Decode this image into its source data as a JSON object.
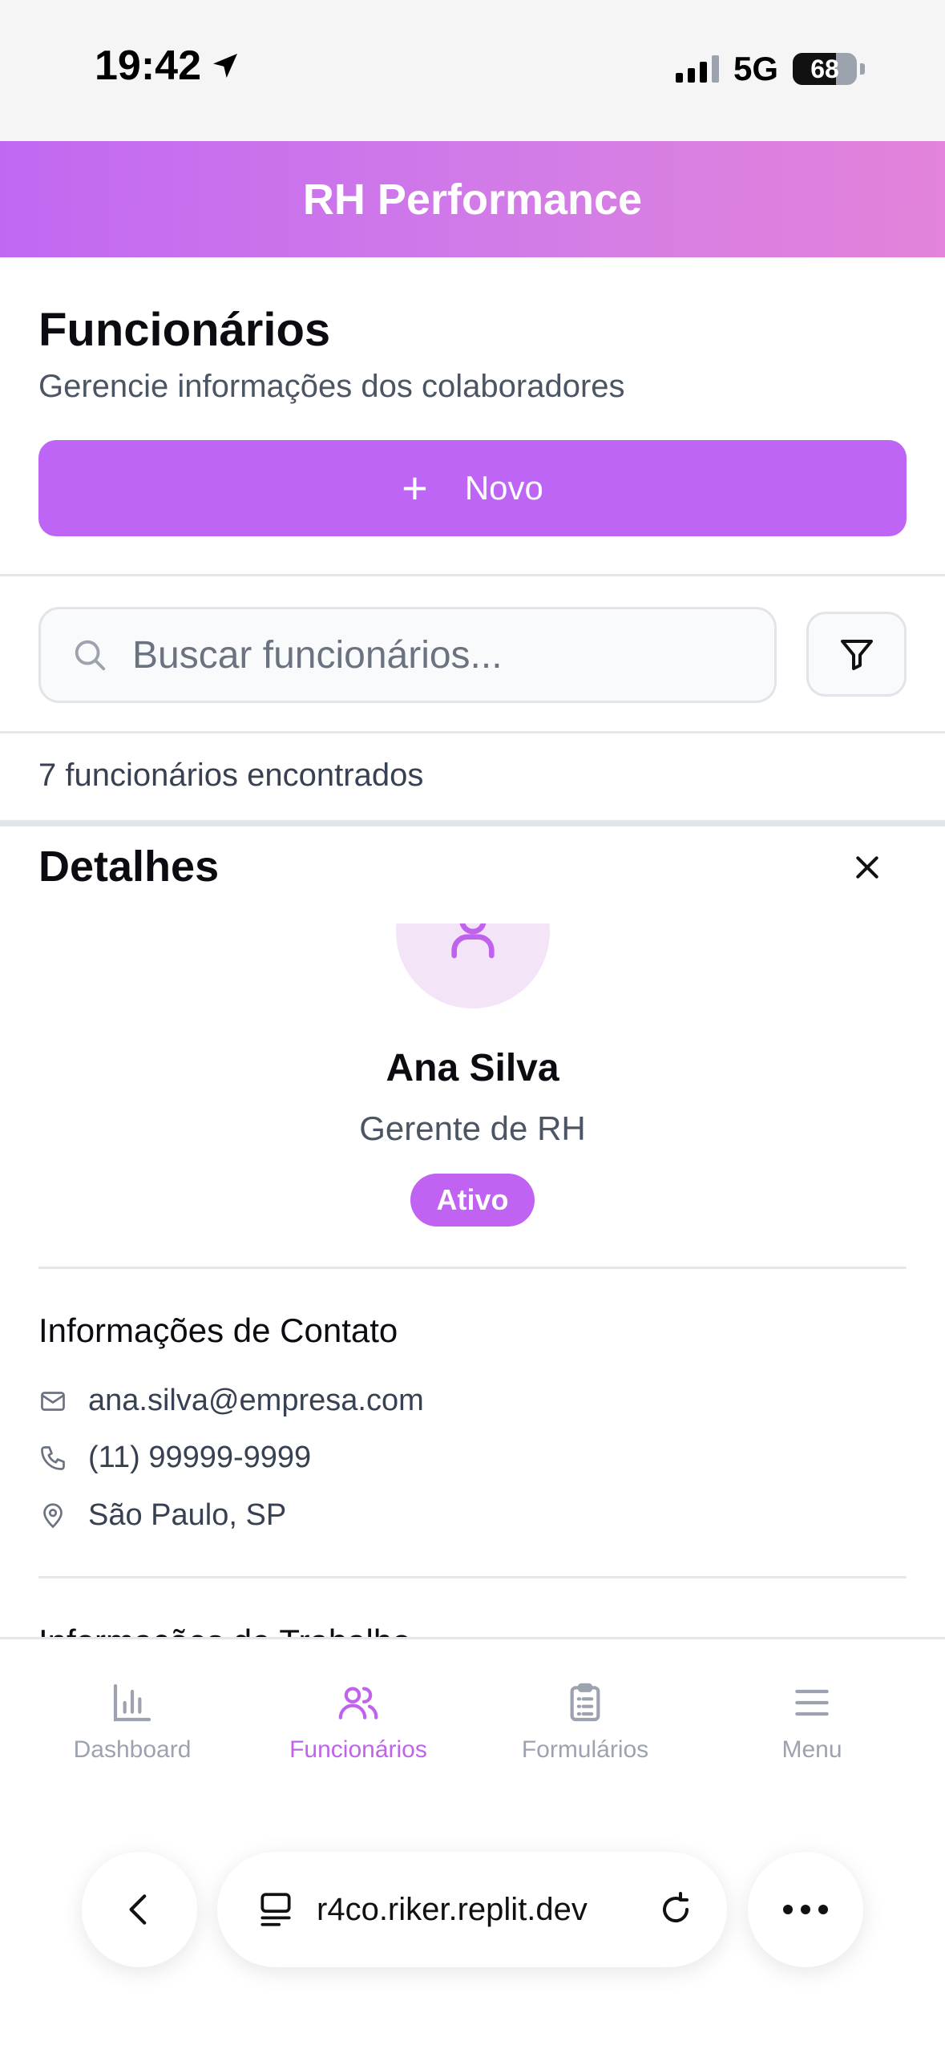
{
  "status_bar": {
    "time": "19:42",
    "network": "5G",
    "battery": "68",
    "battery_level": 0.68
  },
  "header": {
    "app_title": "RH Performance"
  },
  "page": {
    "title": "Funcionários",
    "subtitle": "Gerencie informações dos colaboradores",
    "new_button_label": "Novo"
  },
  "search": {
    "placeholder": "Buscar funcionários..."
  },
  "results": {
    "count_text": "7 funcionários encontrados"
  },
  "details": {
    "title": "Detalhes",
    "name": "Ana Silva",
    "role": "Gerente de RH",
    "status": "Ativo",
    "contact_section_title": "Informações de Contato",
    "email": "ana.silva@empresa.com",
    "phone": "(11) 99999-9999",
    "location": "São Paulo, SP",
    "work_section_title": "Informações de Trabalho"
  },
  "nav": {
    "items": [
      {
        "label": "Dashboard",
        "icon": "bar-chart-icon"
      },
      {
        "label": "Funcionários",
        "icon": "users-icon",
        "active": true
      },
      {
        "label": "Formulários",
        "icon": "clipboard-icon"
      },
      {
        "label": "Menu",
        "icon": "menu-icon"
      }
    ]
  },
  "browser": {
    "url": "r4co.riker.replit.dev"
  },
  "colors": {
    "accent": "#bf65f5",
    "header_start": "#c168f2",
    "header_end": "#e383da",
    "avatar_bg": "#f3e4f8"
  }
}
